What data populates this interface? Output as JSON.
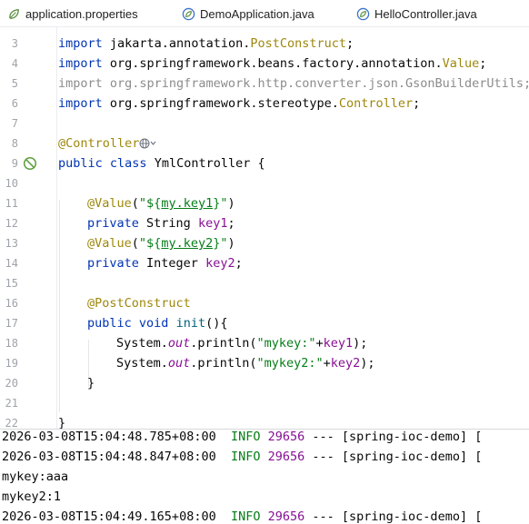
{
  "tabs": [
    {
      "label": "application.properties",
      "icon": "properties-file-icon"
    },
    {
      "label": "DemoApplication.java",
      "icon": "spring-class-icon"
    },
    {
      "label": "HelloController.java",
      "icon": "spring-class-icon"
    }
  ],
  "editor": {
    "line_numbers": [
      "3",
      "4",
      "5",
      "6",
      "7",
      "8",
      "9",
      "10",
      "11",
      "12",
      "13",
      "14",
      "15",
      "16",
      "17",
      "18",
      "19",
      "20",
      "21",
      "22"
    ],
    "l3_kw": "import",
    "l3_pkg": " jakarta.annotation.",
    "l3_cls": "PostConstruct",
    "l3_end": ";",
    "l4_kw": "import",
    "l4_pkg": " org.springframework.beans.factory.annotation.",
    "l4_cls": "Value",
    "l4_end": ";",
    "l5_text": "import org.springframework.http.converter.json.GsonBuilderUtils;",
    "l6_kw": "import",
    "l6_pkg": " org.springframework.stereotype.",
    "l6_cls": "Controller",
    "l6_end": ";",
    "l8_ann": "@Controller",
    "l9_kw1": "public",
    "l9_kw2": " class",
    "l9_name": " YmlController {",
    "l11_ann": "@Value",
    "l11_open": "(",
    "l11_s1": "\"${",
    "l11_key": "my.key1",
    "l11_s2": "}\"",
    "l11_close": ")",
    "l12_kw": "private",
    "l12_type": " String ",
    "l12_field": "key1",
    "l12_end": ";",
    "l13_ann": "@Value",
    "l13_open": "(",
    "l13_s1": "\"${",
    "l13_key": "my.key2",
    "l13_s2": "}\"",
    "l13_close": ")",
    "l14_kw": "private",
    "l14_type": " Integer ",
    "l14_field": "key2",
    "l14_end": ";",
    "l16_ann": "@PostConstruct",
    "l17_kw1": "public",
    "l17_kw2": " void ",
    "l17_method": "init",
    "l17_end": "(){",
    "l18_sys": "System.",
    "l18_out": "out",
    "l18_mid": ".println(",
    "l18_str": "\"mykey:\"",
    "l18_plus": "+",
    "l18_field": "key1",
    "l18_end": ");",
    "l19_sys": "System.",
    "l19_out": "out",
    "l19_mid": ".println(",
    "l19_str": "\"mykey2:\"",
    "l19_plus": "+",
    "l19_field": "key2",
    "l19_end": ");",
    "l20_text": "}",
    "l22_text": "}"
  },
  "console": {
    "lines": [
      {
        "ts": "2026-03-08T15:04:48.785+08:00",
        "level": "INFO",
        "pid": "29656",
        "rest": " --- [spring-ioc-demo] ["
      },
      {
        "ts": "2026-03-08T15:04:48.847+08:00",
        "level": "INFO",
        "pid": "29656",
        "rest": " --- [spring-ioc-demo] ["
      },
      {
        "text": "mykey:aaa"
      },
      {
        "text": "mykey2:1"
      },
      {
        "ts": "2026-03-08T15:04:49.165+08:00",
        "level": "INFO",
        "pid": "29656",
        "rest": " --- [spring-ioc-demo] ["
      }
    ]
  },
  "colors": {
    "keyword": "#0033b3",
    "annotation": "#9e880d",
    "string": "#067d17",
    "field": "#871094",
    "method": "#00627a",
    "unused_import": "#8c8c8c"
  }
}
